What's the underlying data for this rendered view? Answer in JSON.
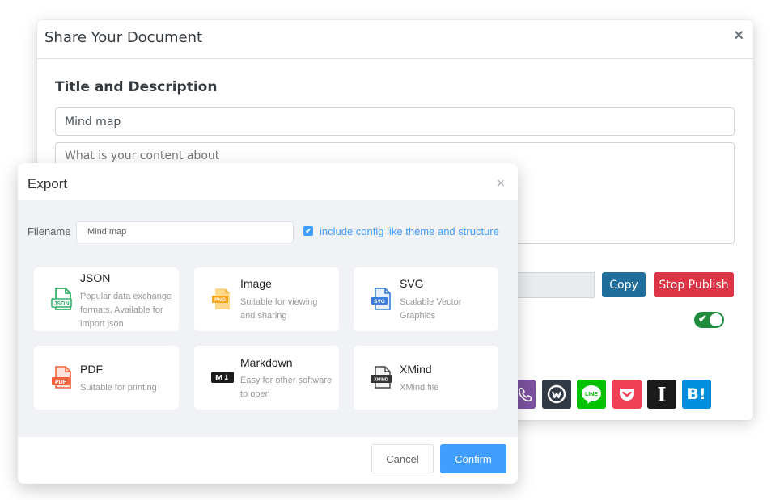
{
  "share_dialog": {
    "title": "Share Your Document",
    "close_glyph": "×",
    "section_title": "Title and Description",
    "title_value": "Mind map",
    "description_placeholder": "What is your content about",
    "copy_label": "Copy",
    "stop_publish_label": "Stop Publish",
    "toggle_on": true,
    "social_icons": [
      "viber-icon",
      "workplace-icon",
      "line-icon",
      "pocket-icon",
      "instapaper-icon",
      "hatena-bookmark-icon"
    ],
    "instapaper_glyph": "I",
    "hatena_glyph": "B!",
    "line_glyph": "LINE",
    "colors": {
      "copy": "#1f6e9c",
      "stop_publish": "#dc3545",
      "toggle": "#1e8a3c"
    }
  },
  "export_dialog": {
    "title": "Export",
    "close_glyph": "×",
    "filename_label": "Filename",
    "filename_value": "Mind map",
    "include_config_checked": true,
    "include_config_label": "include config like theme and structure",
    "formats": [
      {
        "name": "JSON",
        "description": "Popular data exchange formats, Available for import json",
        "icon": "json-file-icon",
        "icon_text": "JSON"
      },
      {
        "name": "Image",
        "description": "Suitable for viewing and sharing",
        "icon": "png-file-icon",
        "icon_text": "PNG"
      },
      {
        "name": "SVG",
        "description": "Scalable Vector Graphics",
        "icon": "svg-file-icon",
        "icon_text": "SVG"
      },
      {
        "name": "PDF",
        "description": "Suitable for printing",
        "icon": "pdf-file-icon",
        "icon_text": "PDF"
      },
      {
        "name": "Markdown",
        "description": "Easy for other software to open",
        "icon": "markdown-icon",
        "icon_text": "M↓"
      },
      {
        "name": "XMind",
        "description": "XMind file",
        "icon": "xmind-file-icon",
        "icon_text": "XMIND"
      }
    ],
    "cancel_label": "Cancel",
    "confirm_label": "Confirm",
    "colors": {
      "accent": "#409eff"
    }
  }
}
